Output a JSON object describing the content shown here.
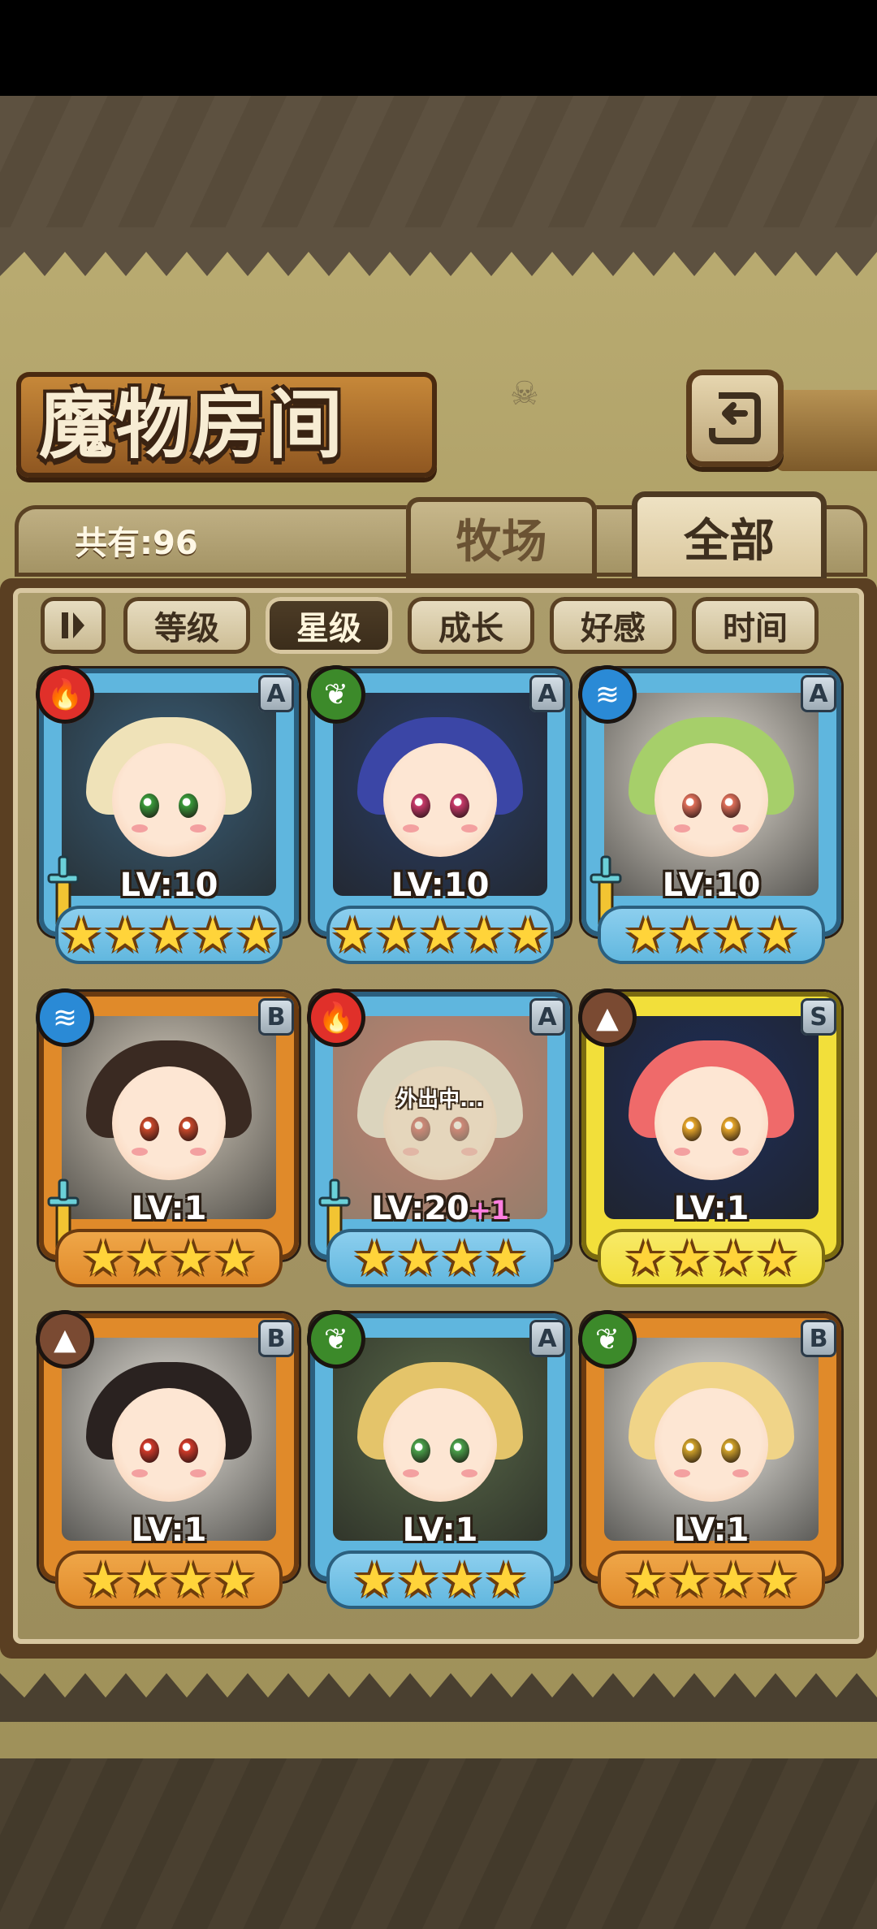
{
  "header": {
    "title": "魔物房间",
    "back_icon": "return-arrow-icon"
  },
  "tabs": [
    {
      "label": "牧场",
      "active": false
    },
    {
      "label": "全部",
      "active": true
    }
  ],
  "count_text": "共有:96",
  "sort": {
    "toggle_icon": "sort-order-toggle-icon",
    "buttons": [
      {
        "label": "等级",
        "active": false
      },
      {
        "label": "星级",
        "active": true
      },
      {
        "label": "成长",
        "active": false
      },
      {
        "label": "好感",
        "active": false
      },
      {
        "label": "时间",
        "active": false
      }
    ]
  },
  "colors": {
    "frame_blue": "#5fb6de",
    "frame_orange": "#e08a2a",
    "frame_gold": "#f2df3a",
    "fire": "#e0302a",
    "nature": "#3c8a2a",
    "water": "#2a8ad6",
    "earth": "#7a4a32"
  },
  "monsters": [
    {
      "element": "fire",
      "element_icon": "fire-icon",
      "rarity": "A",
      "frame": "blue",
      "level": "LV:10",
      "bonus": "",
      "stars": 5,
      "weapon": true,
      "away": false,
      "hair": "#efe2b8",
      "eye": "#3a9a3a",
      "bg": "#3a5e78"
    },
    {
      "element": "nature",
      "element_icon": "leaf-icon",
      "rarity": "A",
      "frame": "blue",
      "level": "LV:10",
      "bonus": "",
      "stars": 5,
      "weapon": false,
      "away": false,
      "hair": "#3b46a6",
      "eye": "#c83a6a",
      "bg": "#2a3e66"
    },
    {
      "element": "water",
      "element_icon": "water-waves-icon",
      "rarity": "A",
      "frame": "blue",
      "level": "LV:10",
      "bonus": "",
      "stars": 4,
      "weapon": true,
      "away": false,
      "hair": "#a6cf6a",
      "eye": "#e0705a",
      "bg": "#e8e2d8"
    },
    {
      "element": "water",
      "element_icon": "water-waves-icon",
      "rarity": "B",
      "frame": "orange",
      "level": "LV:1",
      "bonus": "",
      "stars": 4,
      "weapon": true,
      "away": false,
      "hair": "#3a2a22",
      "eye": "#c8482a",
      "bg": "#d8cfc0"
    },
    {
      "element": "fire",
      "element_icon": "fire-icon",
      "rarity": "A",
      "frame": "blue",
      "level": "LV:20",
      "bonus": "+1",
      "stars": 4,
      "weapon": true,
      "away": true,
      "away_text": "外出中...",
      "hair": "#e6e2d6",
      "eye": "#c83a3a",
      "bg": "#b02a2a"
    },
    {
      "element": "earth",
      "element_icon": "mountain-icon",
      "rarity": "S",
      "frame": "gold",
      "level": "LV:1",
      "bonus": "",
      "stars": 4,
      "weapon": false,
      "away": false,
      "hair": "#ef6a6a",
      "eye": "#e6a62a",
      "bg": "#1e2e5a"
    },
    {
      "element": "earth",
      "element_icon": "mountain-icon",
      "rarity": "B",
      "frame": "orange",
      "level": "LV:1",
      "bonus": "",
      "stars": 4,
      "weapon": false,
      "away": false,
      "hair": "#2a2220",
      "eye": "#d03a2a",
      "bg": "#e8e4dc"
    },
    {
      "element": "nature",
      "element_icon": "leaf-icon",
      "rarity": "A",
      "frame": "blue",
      "level": "LV:1",
      "bonus": "",
      "stars": 4,
      "weapon": false,
      "away": false,
      "hair": "#e4c46a",
      "eye": "#4aa04a",
      "bg": "#5a6a4a"
    },
    {
      "element": "nature",
      "element_icon": "leaf-icon",
      "rarity": "B",
      "frame": "orange",
      "level": "LV:1",
      "bonus": "",
      "stars": 4,
      "weapon": false,
      "away": false,
      "hair": "#f0d488",
      "eye": "#d0a22a",
      "bg": "#f2efe8"
    }
  ]
}
